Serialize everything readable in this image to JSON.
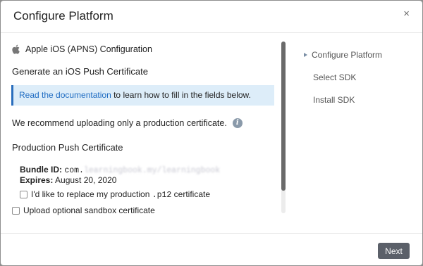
{
  "dialog": {
    "title": "Configure Platform",
    "close_glyph": "×"
  },
  "config": {
    "platform_label": "Apple iOS (APNS) Configuration",
    "platform_icon": "apple-icon",
    "heading": "Generate an iOS Push Certificate",
    "info_link": "Read the documentation",
    "info_text": " to learn how to fill in the fields below.",
    "recommendation": "We recommend uploading only a production certificate.",
    "info_icon_glyph": "i",
    "cert_heading": "Production Push Certificate",
    "bundle_label": "Bundle ID:",
    "bundle_value_prefix": "com.",
    "bundle_value_redacted": "learningbook.my/learningbook",
    "expires_label": "Expires:",
    "expires_value": "August 20, 2020",
    "replace_prefix": "I'd like to replace my production ",
    "replace_code": ".p12",
    "replace_suffix": " certificate",
    "sandbox_label": "Upload optional sandbox certificate"
  },
  "steps": [
    {
      "label": "Configure Platform",
      "active": true
    },
    {
      "label": "Select SDK",
      "active": false
    },
    {
      "label": "Install SDK",
      "active": false
    }
  ],
  "footer": {
    "next_label": "Next"
  },
  "colors": {
    "info_bg": "#ddedf9",
    "info_border": "#2a6ebd",
    "link": "#1f6cc2",
    "button_bg": "#5b6069"
  }
}
